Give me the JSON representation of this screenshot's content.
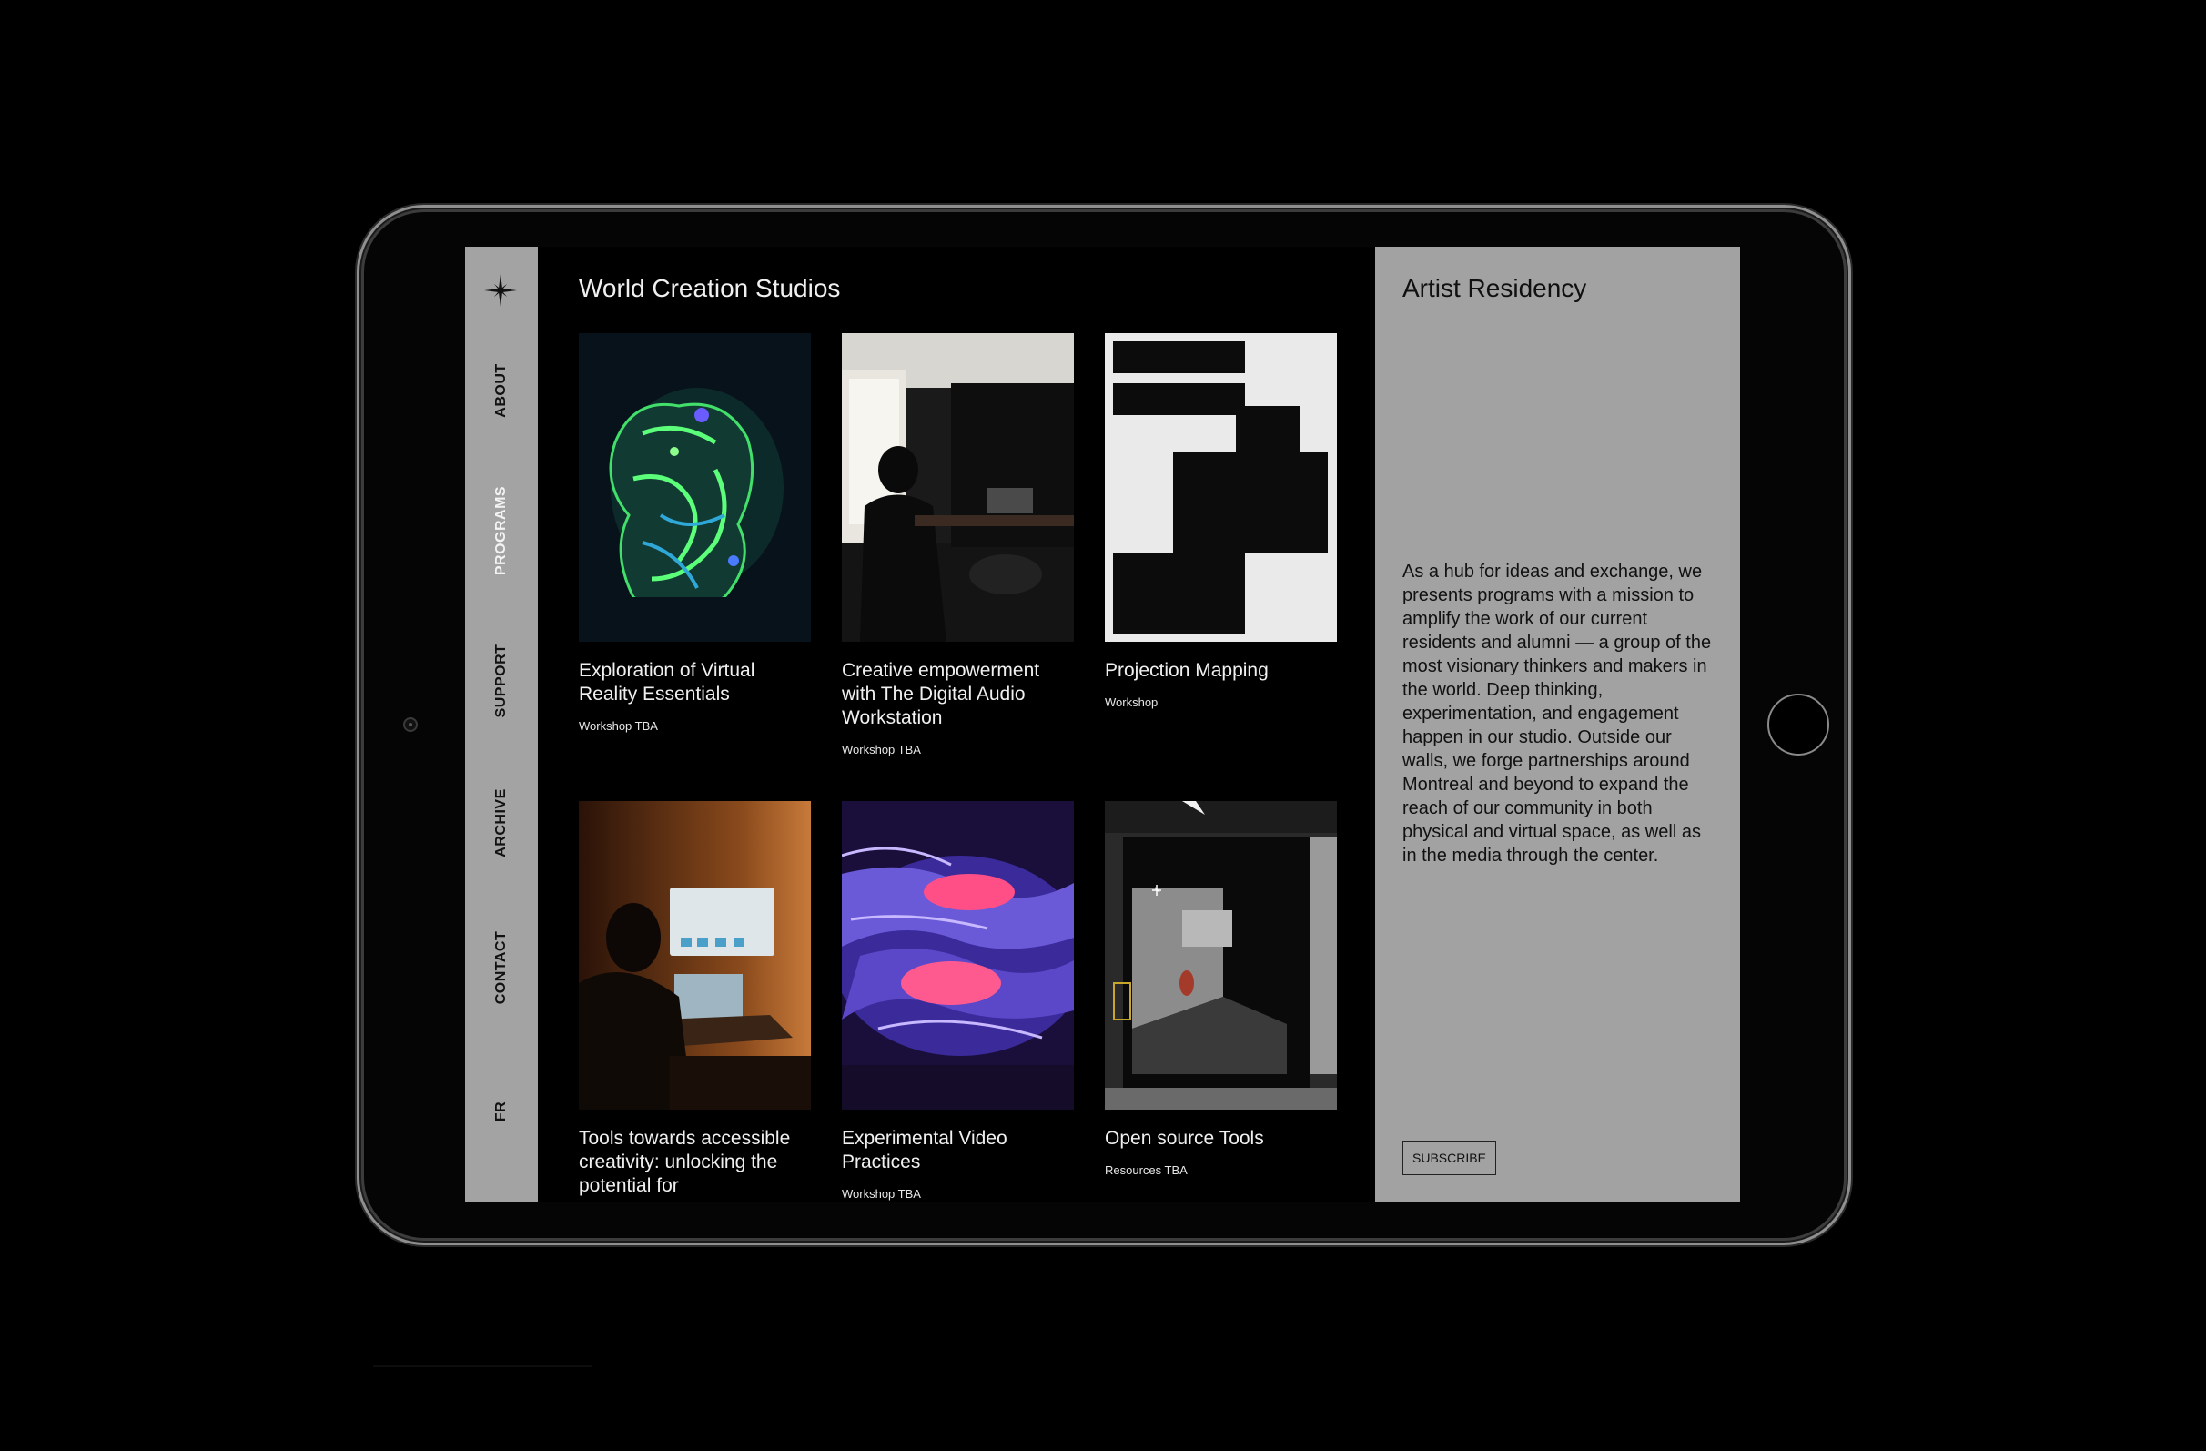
{
  "sidebar": {
    "logo_icon": "four-point-star-icon",
    "items": [
      {
        "label": "ABOUT",
        "active": false
      },
      {
        "label": "PROGRAMS",
        "active": true
      },
      {
        "label": "SUPPORT",
        "active": false
      },
      {
        "label": "ARCHIVE",
        "active": false
      },
      {
        "label": "CONTACT",
        "active": false
      },
      {
        "label": "FR",
        "active": false
      }
    ]
  },
  "main": {
    "title": "World Creation Studios",
    "cards": [
      {
        "title": "Exploration of Virtual Reality Essentials",
        "meta": "Workshop TBA",
        "image": "green-blue-organic-scan"
      },
      {
        "title": "Creative empowerment with The Digital Audio Workstation",
        "meta": "Workshop TBA",
        "image": "person-at-desk-room"
      },
      {
        "title": "Projection Mapping",
        "meta": "Workshop",
        "image": "black-white-blocks"
      },
      {
        "title": "Tools towards accessible creativity: unlocking the potential for",
        "meta": "",
        "image": "person-with-laptop-warm-light"
      },
      {
        "title": "Experimental Video Practices",
        "meta": "Workshop TBA",
        "image": "purple-pink-texture"
      },
      {
        "title": "Open source Tools",
        "meta": "Resources TBA",
        "image": "3d-gallery-space"
      }
    ]
  },
  "panel": {
    "title": "Artist Residency",
    "body": "As a hub for ideas and exchange, we presents programs with a mission to amplify the work of our current residents and alumni — a group of the most visionary thinkers and makers in the world. Deep thinking, experimentation, and engagement happen in our studio. Outside our walls, we forge partnerships around Montreal and beyond to expand the reach of our community in both physical and virtual space, as well as in the media through the center.",
    "subscribe_label": "SUBSCRIBE"
  },
  "colors": {
    "sidebar_bg": "#a3a3a3",
    "panel_bg": "#a2a2a2",
    "main_bg": "#000000",
    "active_nav": "#f3f3f3"
  }
}
